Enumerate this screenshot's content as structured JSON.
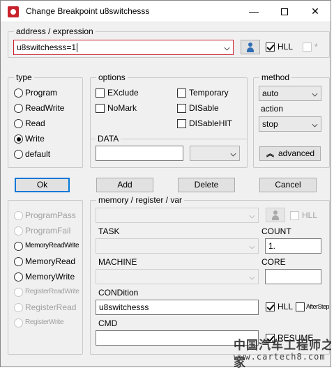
{
  "window": {
    "title": "Change Breakpoint  u8switchesss",
    "minimize_glyph": "—",
    "close_glyph": "✕"
  },
  "address": {
    "label": "address / expression",
    "value": "u8switchesss=1",
    "hll_label": "HLL",
    "hll_checked": true,
    "star_label": "*"
  },
  "type": {
    "label": "type",
    "options": [
      "Program",
      "ReadWrite",
      "Read",
      "Write",
      "default"
    ],
    "selected": "Write"
  },
  "options": {
    "label": "options",
    "exclude": "EXclude",
    "temporary": "Temporary",
    "nomark": "NoMark",
    "disable": "DISable",
    "disablehit": "DISableHIT",
    "data_label": "DATA"
  },
  "method": {
    "label": "method",
    "value": "auto",
    "action_label": "action",
    "action_value": "stop",
    "advanced_label": "advanced"
  },
  "buttons": {
    "ok": "Ok",
    "add": "Add",
    "delete": "Delete",
    "cancel": "Cancel"
  },
  "impl": {
    "options": [
      "ProgramPass",
      "ProgramFail",
      "MemoryReadWrite",
      "MemoryRead",
      "MemoryWrite",
      "RegisterReadWrite",
      "RegisterRead",
      "RegisterWrite"
    ]
  },
  "memory": {
    "label": "memory / register / var",
    "hll_label": "HLL",
    "task_label": "TASK",
    "count_label": "COUNT",
    "count_value": "1.",
    "machine_label": "MACHINE",
    "core_label": "CORE",
    "condition_label": "CONDition",
    "condition_value": "u8switchesss",
    "condition_hll_label": "HLL",
    "afterstep_label": "AfterStep",
    "cmd_label": "CMD",
    "resume_label": "RESUME"
  },
  "watermark": {
    "top": "中国汽车工程师之家",
    "bottom": "www.cartech8.com"
  },
  "colors": {
    "focus_border": "#c8232c",
    "default_button_border": "#0078d7",
    "person_icon": "#2f6db3"
  }
}
